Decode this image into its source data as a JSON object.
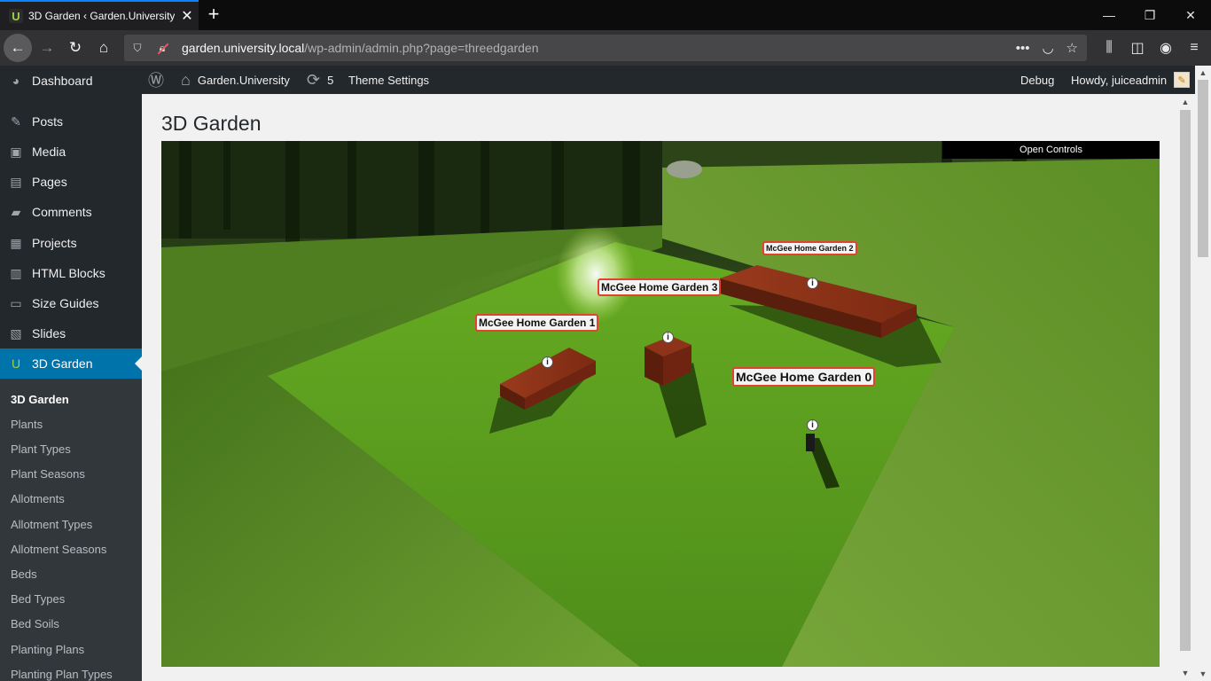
{
  "browser": {
    "tab_title": "3D Garden ‹ Garden.University —",
    "favicon_letter": "U",
    "url_host": "garden.university.local",
    "url_path": "/wp-admin/admin.php?page=threedgarden",
    "new_tab": "+",
    "close": "✕",
    "minimize": "—",
    "restore": "❐",
    "window_close": "✕"
  },
  "admin_menu": {
    "items": [
      {
        "label": "Dashboard",
        "icon": "dashboard-icon"
      },
      {
        "label": "Posts",
        "icon": "pin-icon"
      },
      {
        "label": "Media",
        "icon": "media-icon"
      },
      {
        "label": "Pages",
        "icon": "pages-icon"
      },
      {
        "label": "Comments",
        "icon": "comment-icon"
      },
      {
        "label": "Projects",
        "icon": "portfolio-icon"
      },
      {
        "label": "HTML Blocks",
        "icon": "blocks-icon"
      },
      {
        "label": "Size Guides",
        "icon": "ruler-icon"
      },
      {
        "label": "Slides",
        "icon": "slides-icon"
      },
      {
        "label": "3D Garden",
        "icon": "garden-icon"
      }
    ],
    "submenu": [
      "3D Garden",
      "Plants",
      "Plant Types",
      "Plant Seasons",
      "Allotments",
      "Allotment Types",
      "Allotment Seasons",
      "Beds",
      "Bed Types",
      "Bed Soils",
      "Planting Plans",
      "Planting Plan Types"
    ]
  },
  "admin_bar": {
    "site_name": "Garden.University",
    "updates_count": "5",
    "theme_settings": "Theme Settings",
    "debug": "Debug",
    "howdy": "Howdy, juiceadmin"
  },
  "page": {
    "title": "3D Garden"
  },
  "scene": {
    "open_controls": "Open Controls",
    "labels": [
      {
        "text": "McGee Home Garden 0"
      },
      {
        "text": "McGee Home Garden 1"
      },
      {
        "text": "McGee Home Garden 2"
      },
      {
        "text": "McGee Home Garden 3"
      }
    ],
    "info_glyph": "i"
  },
  "colors": {
    "admin_menu_bg": "#23282d",
    "admin_menu_current": "#0073aa",
    "submenu_bg": "#32373c",
    "label_border": "#e0442a",
    "grass": "#5aa022",
    "bed_wood": "#7a2a14"
  }
}
